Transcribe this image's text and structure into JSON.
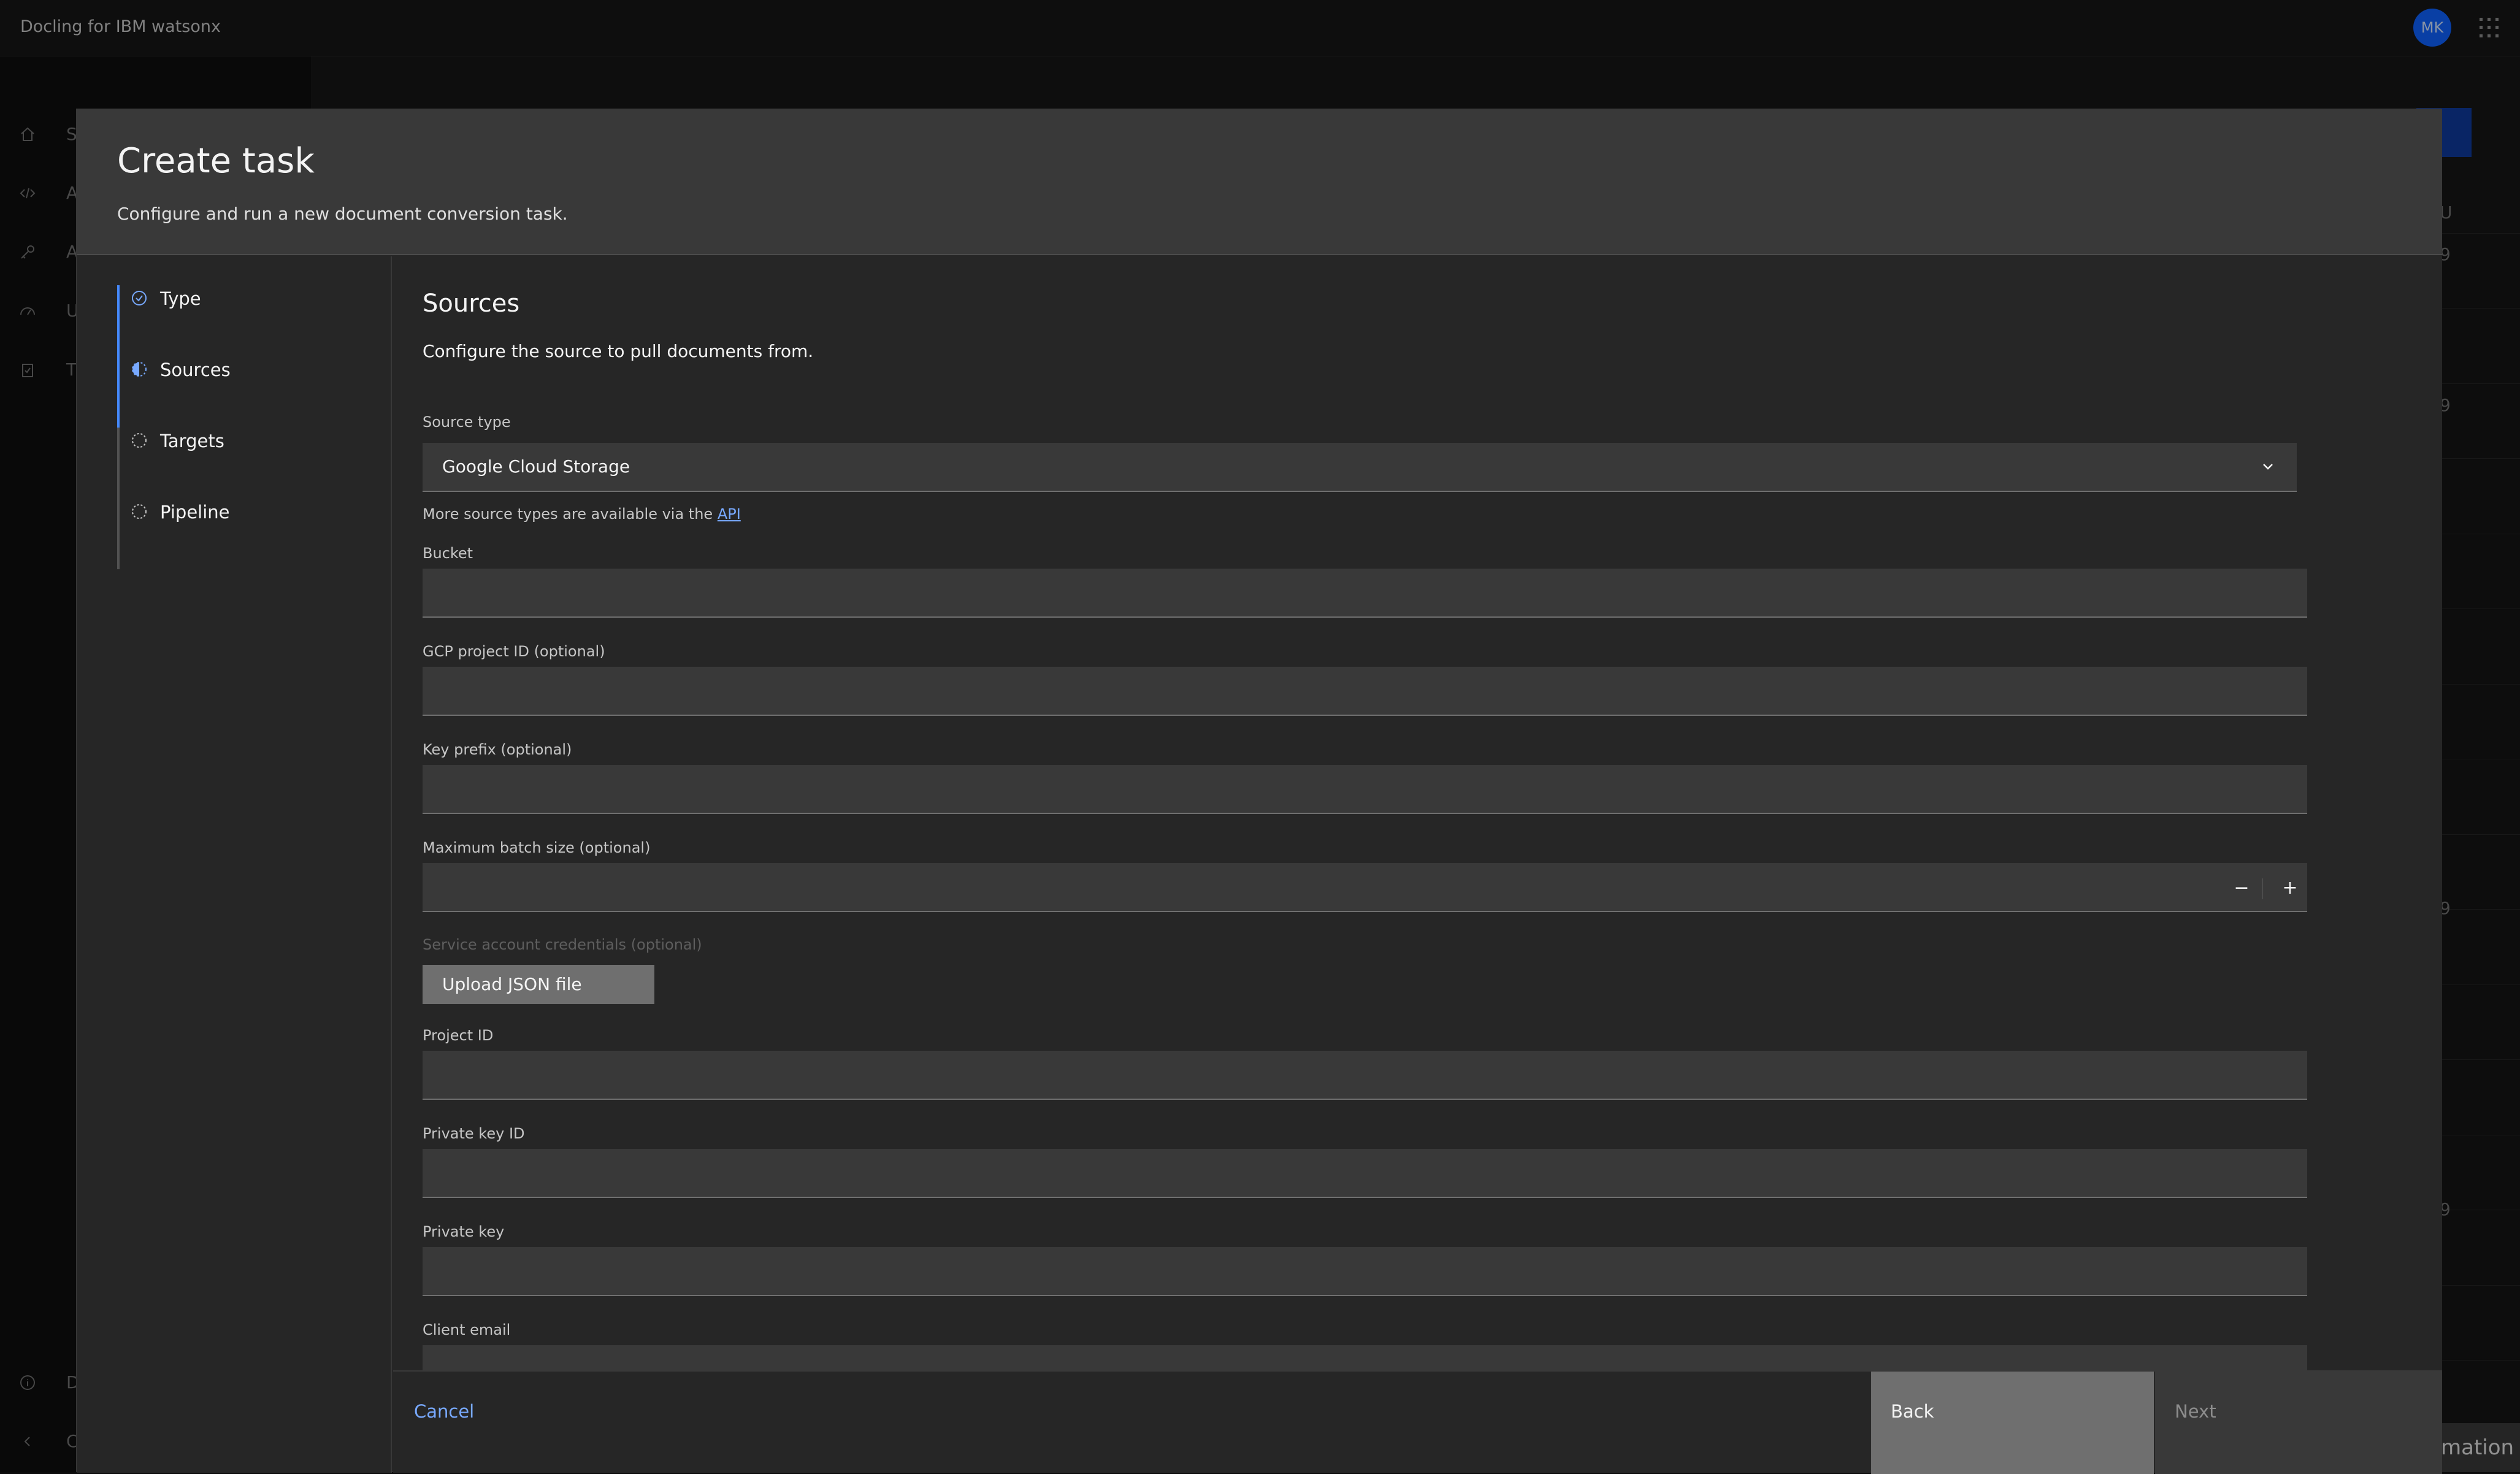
{
  "header": {
    "app_title": "Docling for IBM watsonx",
    "avatar_initials": "MK"
  },
  "sidenav": {
    "items": [
      {
        "icon": "home-icon",
        "label": "Start"
      },
      {
        "icon": "code-icon",
        "label": "A"
      },
      {
        "icon": "key-icon",
        "label": "A"
      },
      {
        "icon": "gauge-icon",
        "label": "U"
      },
      {
        "icon": "clipboard-icon",
        "label": "T"
      }
    ],
    "footer_items": [
      {
        "icon": "info-icon",
        "label": "D"
      },
      {
        "icon": "chevron-left-icon",
        "label": "C"
      }
    ]
  },
  "background": {
    "column_header": "U",
    "row_values": [
      "9",
      "9",
      "9",
      "9"
    ],
    "toast_text": "mation"
  },
  "modal": {
    "title": "Create task",
    "subtitle": "Configure and run a new document conversion task.",
    "steps": [
      {
        "label": "Type",
        "state": "complete"
      },
      {
        "label": "Sources",
        "state": "current"
      },
      {
        "label": "Targets",
        "state": "incomplete"
      },
      {
        "label": "Pipeline",
        "state": "incomplete"
      }
    ],
    "section": {
      "title": "Sources",
      "description": "Configure the source to pull documents from.",
      "source_type_label": "Source type",
      "source_type_value": "Google Cloud Storage",
      "helper_text": "More source types are available via the ",
      "helper_link": "API",
      "fields": {
        "bucket": {
          "label": "Bucket",
          "value": ""
        },
        "gcp_project_id": {
          "label": "GCP project ID (optional)",
          "value": ""
        },
        "key_prefix": {
          "label": "Key prefix (optional)",
          "value": ""
        },
        "max_batch": {
          "label": "Maximum batch size (optional)",
          "value": ""
        },
        "service_account": {
          "label": "Service account credentials (optional)"
        },
        "project_id": {
          "label": "Project ID",
          "value": ""
        },
        "private_key_id": {
          "label": "Private key ID",
          "value": ""
        },
        "private_key": {
          "label": "Private key",
          "value": ""
        },
        "client_email": {
          "label": "Client email",
          "value": ""
        }
      },
      "upload_label": "Upload JSON file",
      "stepper_minus": "−",
      "stepper_plus": "+"
    },
    "footer": {
      "cancel": "Cancel",
      "back": "Back",
      "next": "Next"
    }
  },
  "colors": {
    "accent": "#4589ff",
    "link": "#78a9ff",
    "surface": "#262626",
    "field": "#393939"
  }
}
